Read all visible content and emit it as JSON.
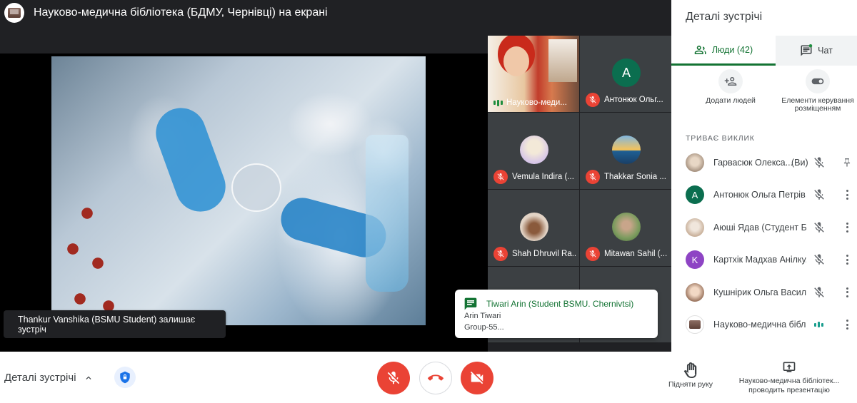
{
  "window": {
    "presenting_title": "Науково-медична бібліотека (БДМУ, Чернівці) на екрані"
  },
  "toast": {
    "leave": "Thankur Vanshika (BSMU Student) залишає зустріч"
  },
  "tiles": [
    {
      "name": "Науково-меди...",
      "muted": false,
      "speaking": true,
      "kind": "photo"
    },
    {
      "name": "Антонюк Ольг...",
      "muted": true,
      "initial": "A",
      "color": "#0b6e4f"
    },
    {
      "name": "Vemula Indira (...",
      "muted": true,
      "color": "#d7c6e8"
    },
    {
      "name": "Thakkar Sonia ...",
      "muted": true,
      "color": "#2e7fb8"
    },
    {
      "name": "Shah Dhruvil Ra...",
      "muted": true,
      "color": "#e2d3c5"
    },
    {
      "name": "Mitawan Sahil (...",
      "muted": true,
      "color": "#7b9b5e"
    }
  ],
  "chat_toast": {
    "title": "Tiwari Arin (Student BSMU. Chernivtsi)",
    "author": "Arin Tiwari",
    "message": "Group-55..."
  },
  "panel": {
    "title": "Деталі зустрічі",
    "tab_people": "Люди (42)",
    "tab_chat": "Чат",
    "add_people": "Додати людей",
    "host_controls": "Елементи керування розміщенням",
    "section_label": "ТРИВАЄ ВИКЛИК",
    "you_label": "(Ви)",
    "people": [
      {
        "name": "Гарвасюк Олекса...",
        "is_you": true,
        "avatar_color": "#c9b8a6"
      },
      {
        "name": "Антонюк Ольга Петрів...",
        "initial": "A",
        "avatar_color": "#0b6e4f"
      },
      {
        "name": "Аюші Ядав (Студент Б...",
        "avatar_color": "#d9c5b2"
      },
      {
        "name": "Картхік Мадхав Анілку...",
        "initial": "K",
        "avatar_color": "#8e44c4"
      },
      {
        "name": "Кушнірик Ольга Васил...",
        "avatar_color": "#c8a890"
      },
      {
        "name": "Науково-медична бібл...",
        "avatar_color": "#6d4c41",
        "speaking": true
      }
    ]
  },
  "bottom": {
    "details": "Деталі зустрічі",
    "raise_hand": "Підняти руку",
    "presenting": "Науково-медична бібліотек... проводить презентацію"
  },
  "colors": {
    "accent": "#137333",
    "danger": "#ea4335",
    "dark": "#202124"
  }
}
